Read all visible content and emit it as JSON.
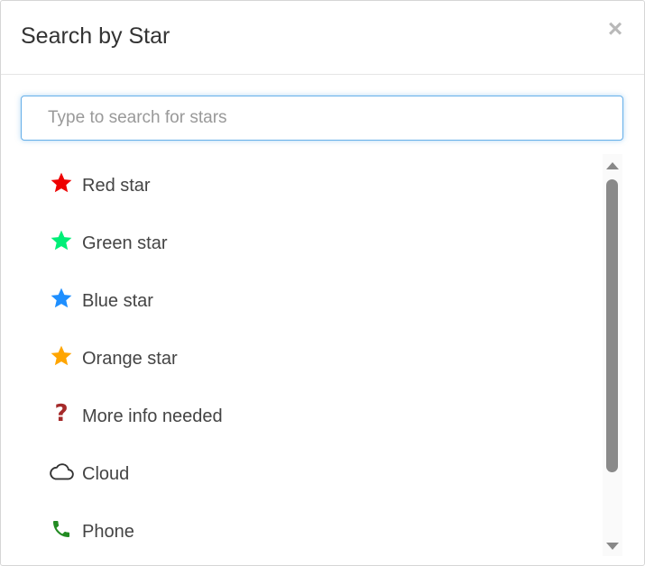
{
  "dialog": {
    "title": "Search by Star",
    "close_symbol": "×"
  },
  "search": {
    "placeholder": "Type to search for stars",
    "value": ""
  },
  "items": [
    {
      "label": "Red star",
      "icon": "star-icon",
      "color": "#ee0000"
    },
    {
      "label": "Green star",
      "icon": "star-icon",
      "color": "#00ee77"
    },
    {
      "label": "Blue star",
      "icon": "star-icon",
      "color": "#1e8fff"
    },
    {
      "label": "Orange star",
      "icon": "star-icon",
      "color": "#ffa500"
    },
    {
      "label": "More info needed",
      "icon": "question-icon",
      "icon_text": "?",
      "color": "#a52a2a"
    },
    {
      "label": "Cloud",
      "icon": "cloud-icon",
      "color": "#333333"
    },
    {
      "label": "Phone",
      "icon": "phone-icon",
      "color": "#228b22"
    }
  ],
  "colors": {
    "accent_focus": "#66afe9",
    "scroll_thumb": "#8a8a8a"
  }
}
